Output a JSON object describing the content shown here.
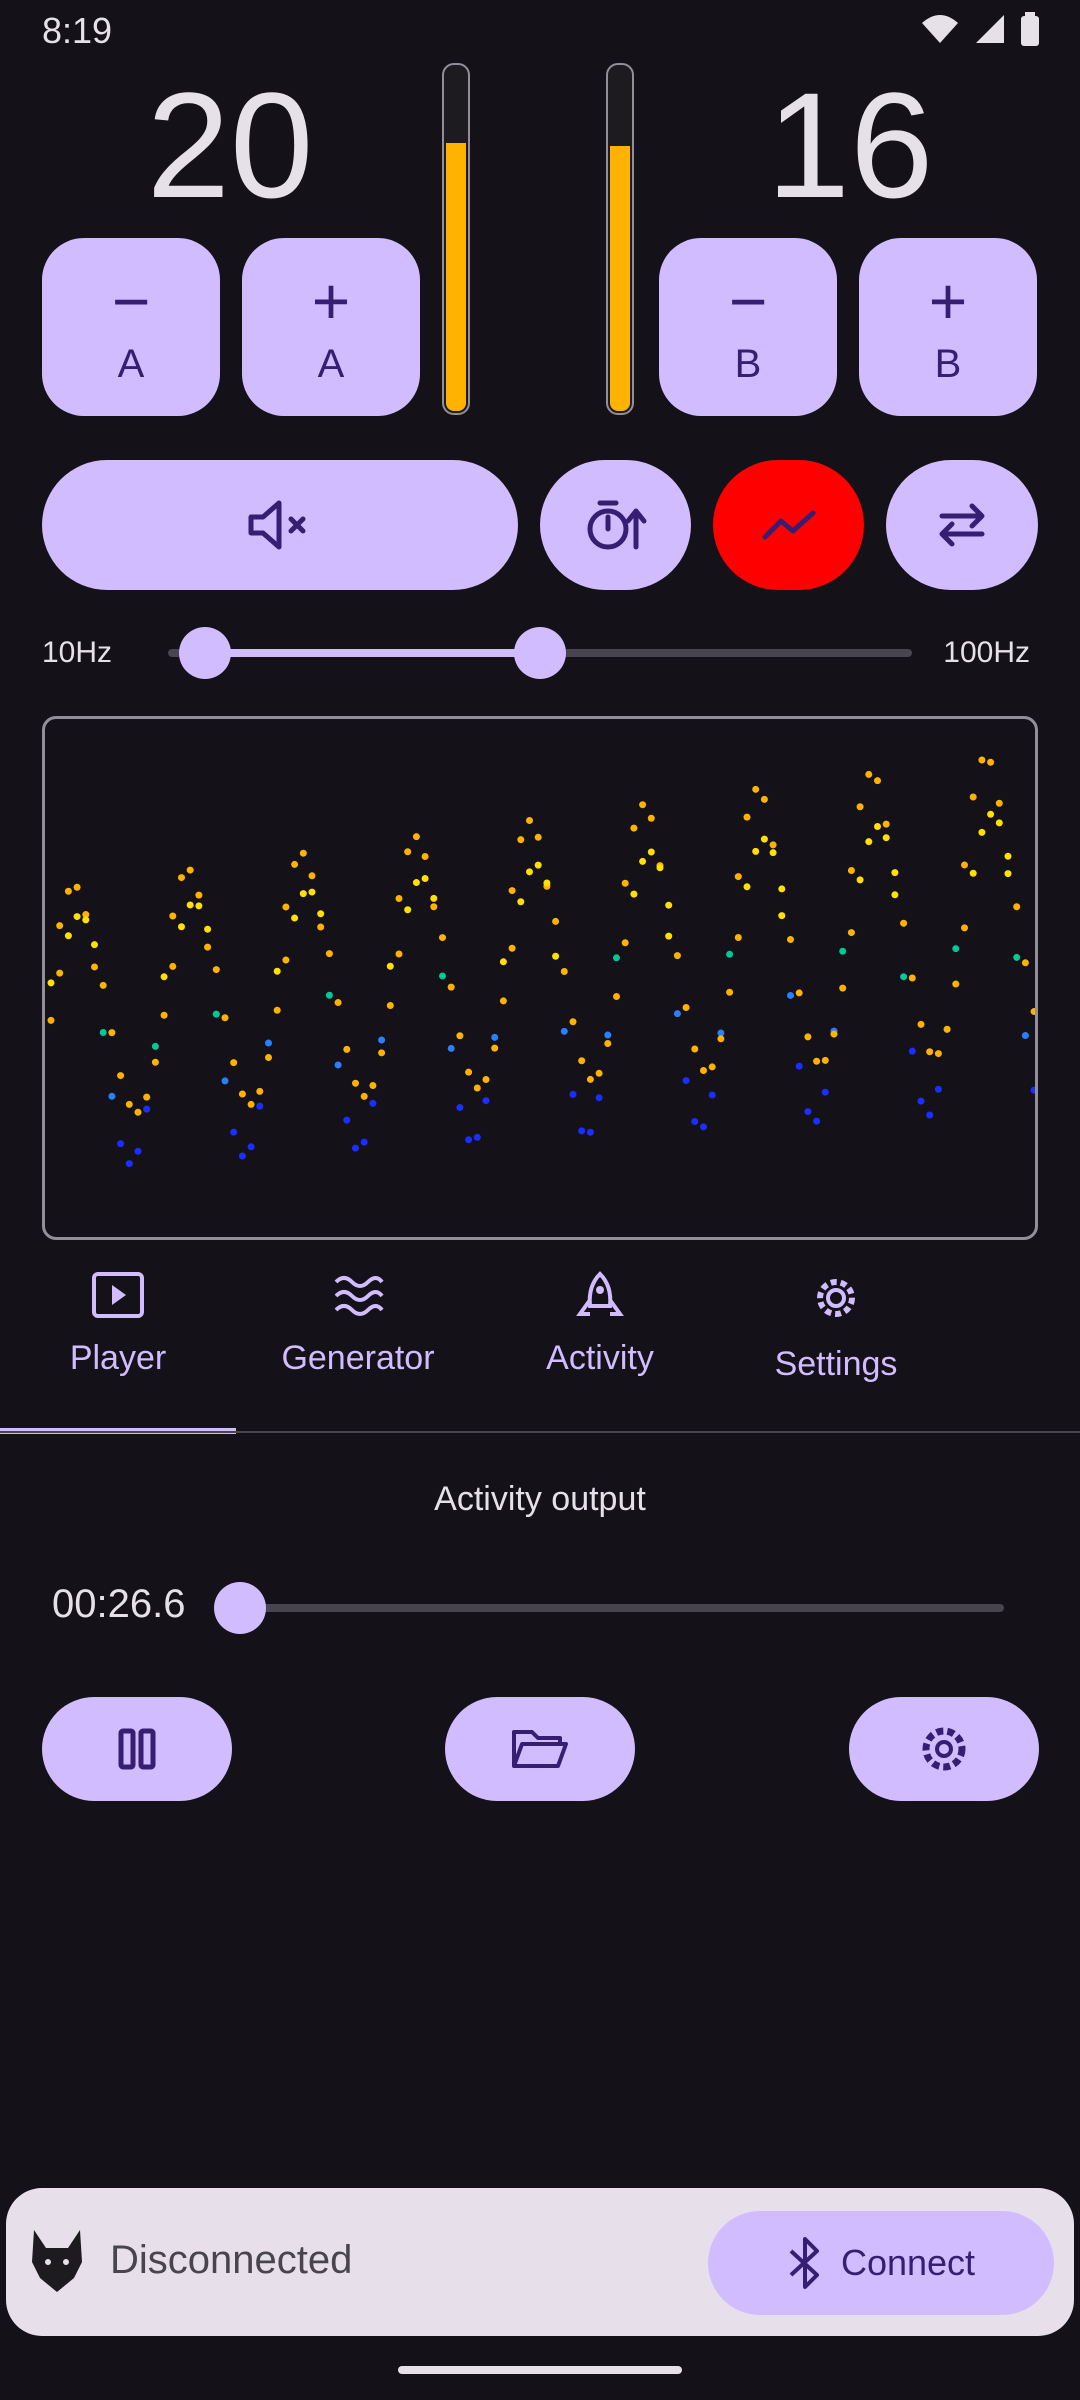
{
  "status": {
    "time": "8:19"
  },
  "channels": {
    "a": {
      "value": "20",
      "level": 0.78,
      "minus_label": "A",
      "plus_label": "A"
    },
    "b": {
      "value": "16",
      "level": 0.77,
      "minus_label": "B",
      "plus_label": "B"
    }
  },
  "frequency": {
    "min_label": "10Hz",
    "max_label": "100Hz",
    "range_low": 0.05,
    "range_high": 0.5
  },
  "tabs": [
    {
      "label": "Player",
      "icon": "play-box-icon",
      "active": true
    },
    {
      "label": "Generator",
      "icon": "waves-icon",
      "active": false
    },
    {
      "label": "Activity",
      "icon": "rocket-icon",
      "active": false
    },
    {
      "label": "Settings",
      "icon": "gear-icon",
      "active": false
    }
  ],
  "player": {
    "title": "Activity output",
    "position": "00:26.6",
    "progress": 0.0
  },
  "connection": {
    "status": "Disconnected",
    "connect_label": "Connect"
  },
  "colors": {
    "accent": "#d0bcff",
    "meter": "#ffb300",
    "active_toggle": "#ff0000",
    "background": "#141218"
  }
}
